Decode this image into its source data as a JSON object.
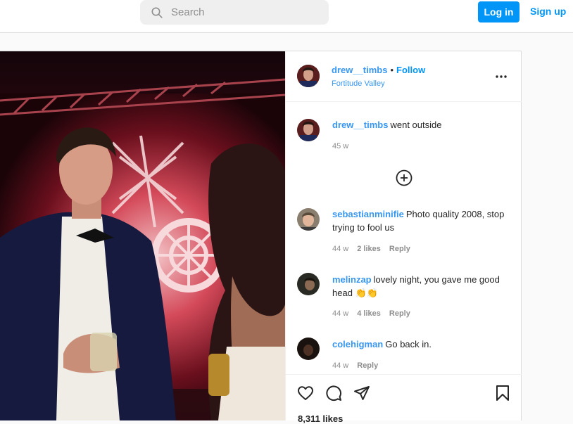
{
  "topbar": {
    "search_placeholder": "Search",
    "login_label": "Log in",
    "signup_label": "Sign up"
  },
  "post": {
    "author": "drew__timbs",
    "separator": "•",
    "follow_label": "Follow",
    "location": "Fortitude Valley",
    "caption": {
      "username": "drew__timbs",
      "text": "went outside",
      "time": "45 w"
    },
    "comments": [
      {
        "username": "sebastianminifie",
        "text": "Photo quality 2008, stop trying to fool us",
        "time": "44 w",
        "likes": "2 likes",
        "reply": "Reply"
      },
      {
        "username": "melinzap",
        "text": "lovely night, you gave me good head 👏👏",
        "time": "44 w",
        "likes": "4 likes",
        "reply": "Reply"
      },
      {
        "username": "colehigman",
        "text": "Go back in.",
        "time": "44 w",
        "reply": "Reply"
      }
    ],
    "likes_count": "8,311 likes"
  },
  "colors": {
    "accent": "#0095f6",
    "username_link": "#3897f0",
    "muted": "#8e8e8e"
  }
}
